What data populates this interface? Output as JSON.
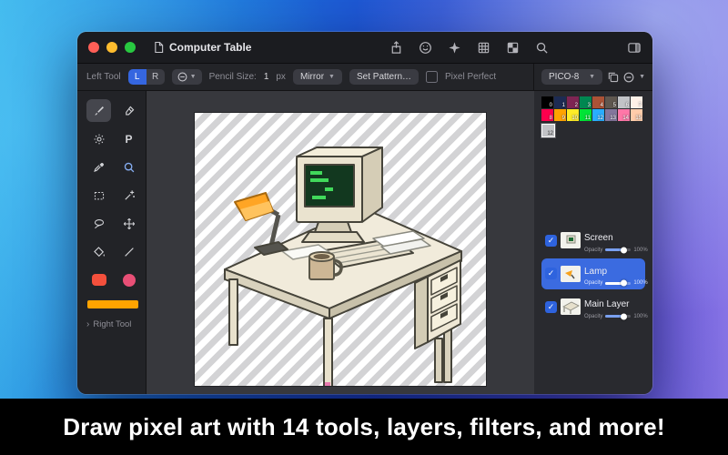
{
  "colors": {
    "accent": "#2E63DE",
    "selection": "#3B6BE0",
    "traffic_lights": [
      "#FF5F57",
      "#FEBC2E",
      "#28C840"
    ]
  },
  "titlebar": {
    "title": "Computer Table",
    "icons": [
      "document",
      "share",
      "sticker",
      "shapes",
      "grid",
      "checkerboard",
      "search",
      "panel-toggle"
    ]
  },
  "toolbar": {
    "left_tool_label": "Left Tool",
    "segment_left": "L",
    "segment_right": "R",
    "pencil_size_label": "Pencil Size:",
    "pencil_size_value": "1",
    "pencil_size_unit": "px",
    "mirror_button": "Mirror",
    "set_pattern_button": "Set Pattern…",
    "pixel_perfect_label": "Pixel Perfect"
  },
  "sidebar": {
    "tools": [
      "brush",
      "eraser",
      "lighten",
      "pencil",
      "eyedropper",
      "zoom",
      "rect-select",
      "magic-wand",
      "lasso",
      "move",
      "fill-bucket",
      "line",
      "rect-shape",
      "ellipse-shape"
    ],
    "active_tool": "brush",
    "pencil_label": "P",
    "current_color": "#FFA300",
    "right_tool_label": "Right Tool"
  },
  "right_panel": {
    "palette_name": "PICO-8",
    "palette": [
      {
        "index": 0,
        "color": "#000000"
      },
      {
        "index": 1,
        "color": "#1D2B53"
      },
      {
        "index": 2,
        "color": "#7E2553"
      },
      {
        "index": 3,
        "color": "#008751"
      },
      {
        "index": 4,
        "color": "#AB5236"
      },
      {
        "index": 5,
        "color": "#5F574F"
      },
      {
        "index": 6,
        "color": "#C2C3C7"
      },
      {
        "index": 7,
        "color": "#FFF1E8"
      },
      {
        "index": 8,
        "color": "#FF004D"
      },
      {
        "index": 9,
        "color": "#FFA300"
      },
      {
        "index": 10,
        "color": "#FFEC27"
      },
      {
        "index": 11,
        "color": "#00E436"
      },
      {
        "index": 12,
        "color": "#29ADFF"
      },
      {
        "index": 13,
        "color": "#83769C"
      },
      {
        "index": 14,
        "color": "#FF77A8"
      },
      {
        "index": 15,
        "color": "#FFCCAA"
      }
    ],
    "selected_swatch": {
      "index": "12",
      "color": "#C2C3C7"
    },
    "layers": [
      {
        "name": "Screen",
        "opacity_label": "Opacity",
        "opacity_value": "100%",
        "checked": true,
        "selected": false
      },
      {
        "name": "Lamp",
        "opacity_label": "Opacity",
        "opacity_value": "100%",
        "checked": true,
        "selected": true
      },
      {
        "name": "Main Layer",
        "opacity_label": "Opacity",
        "opacity_value": "100%",
        "checked": true,
        "selected": false
      }
    ]
  },
  "caption": "Draw pixel art with 14 tools, layers, filters, and more!"
}
